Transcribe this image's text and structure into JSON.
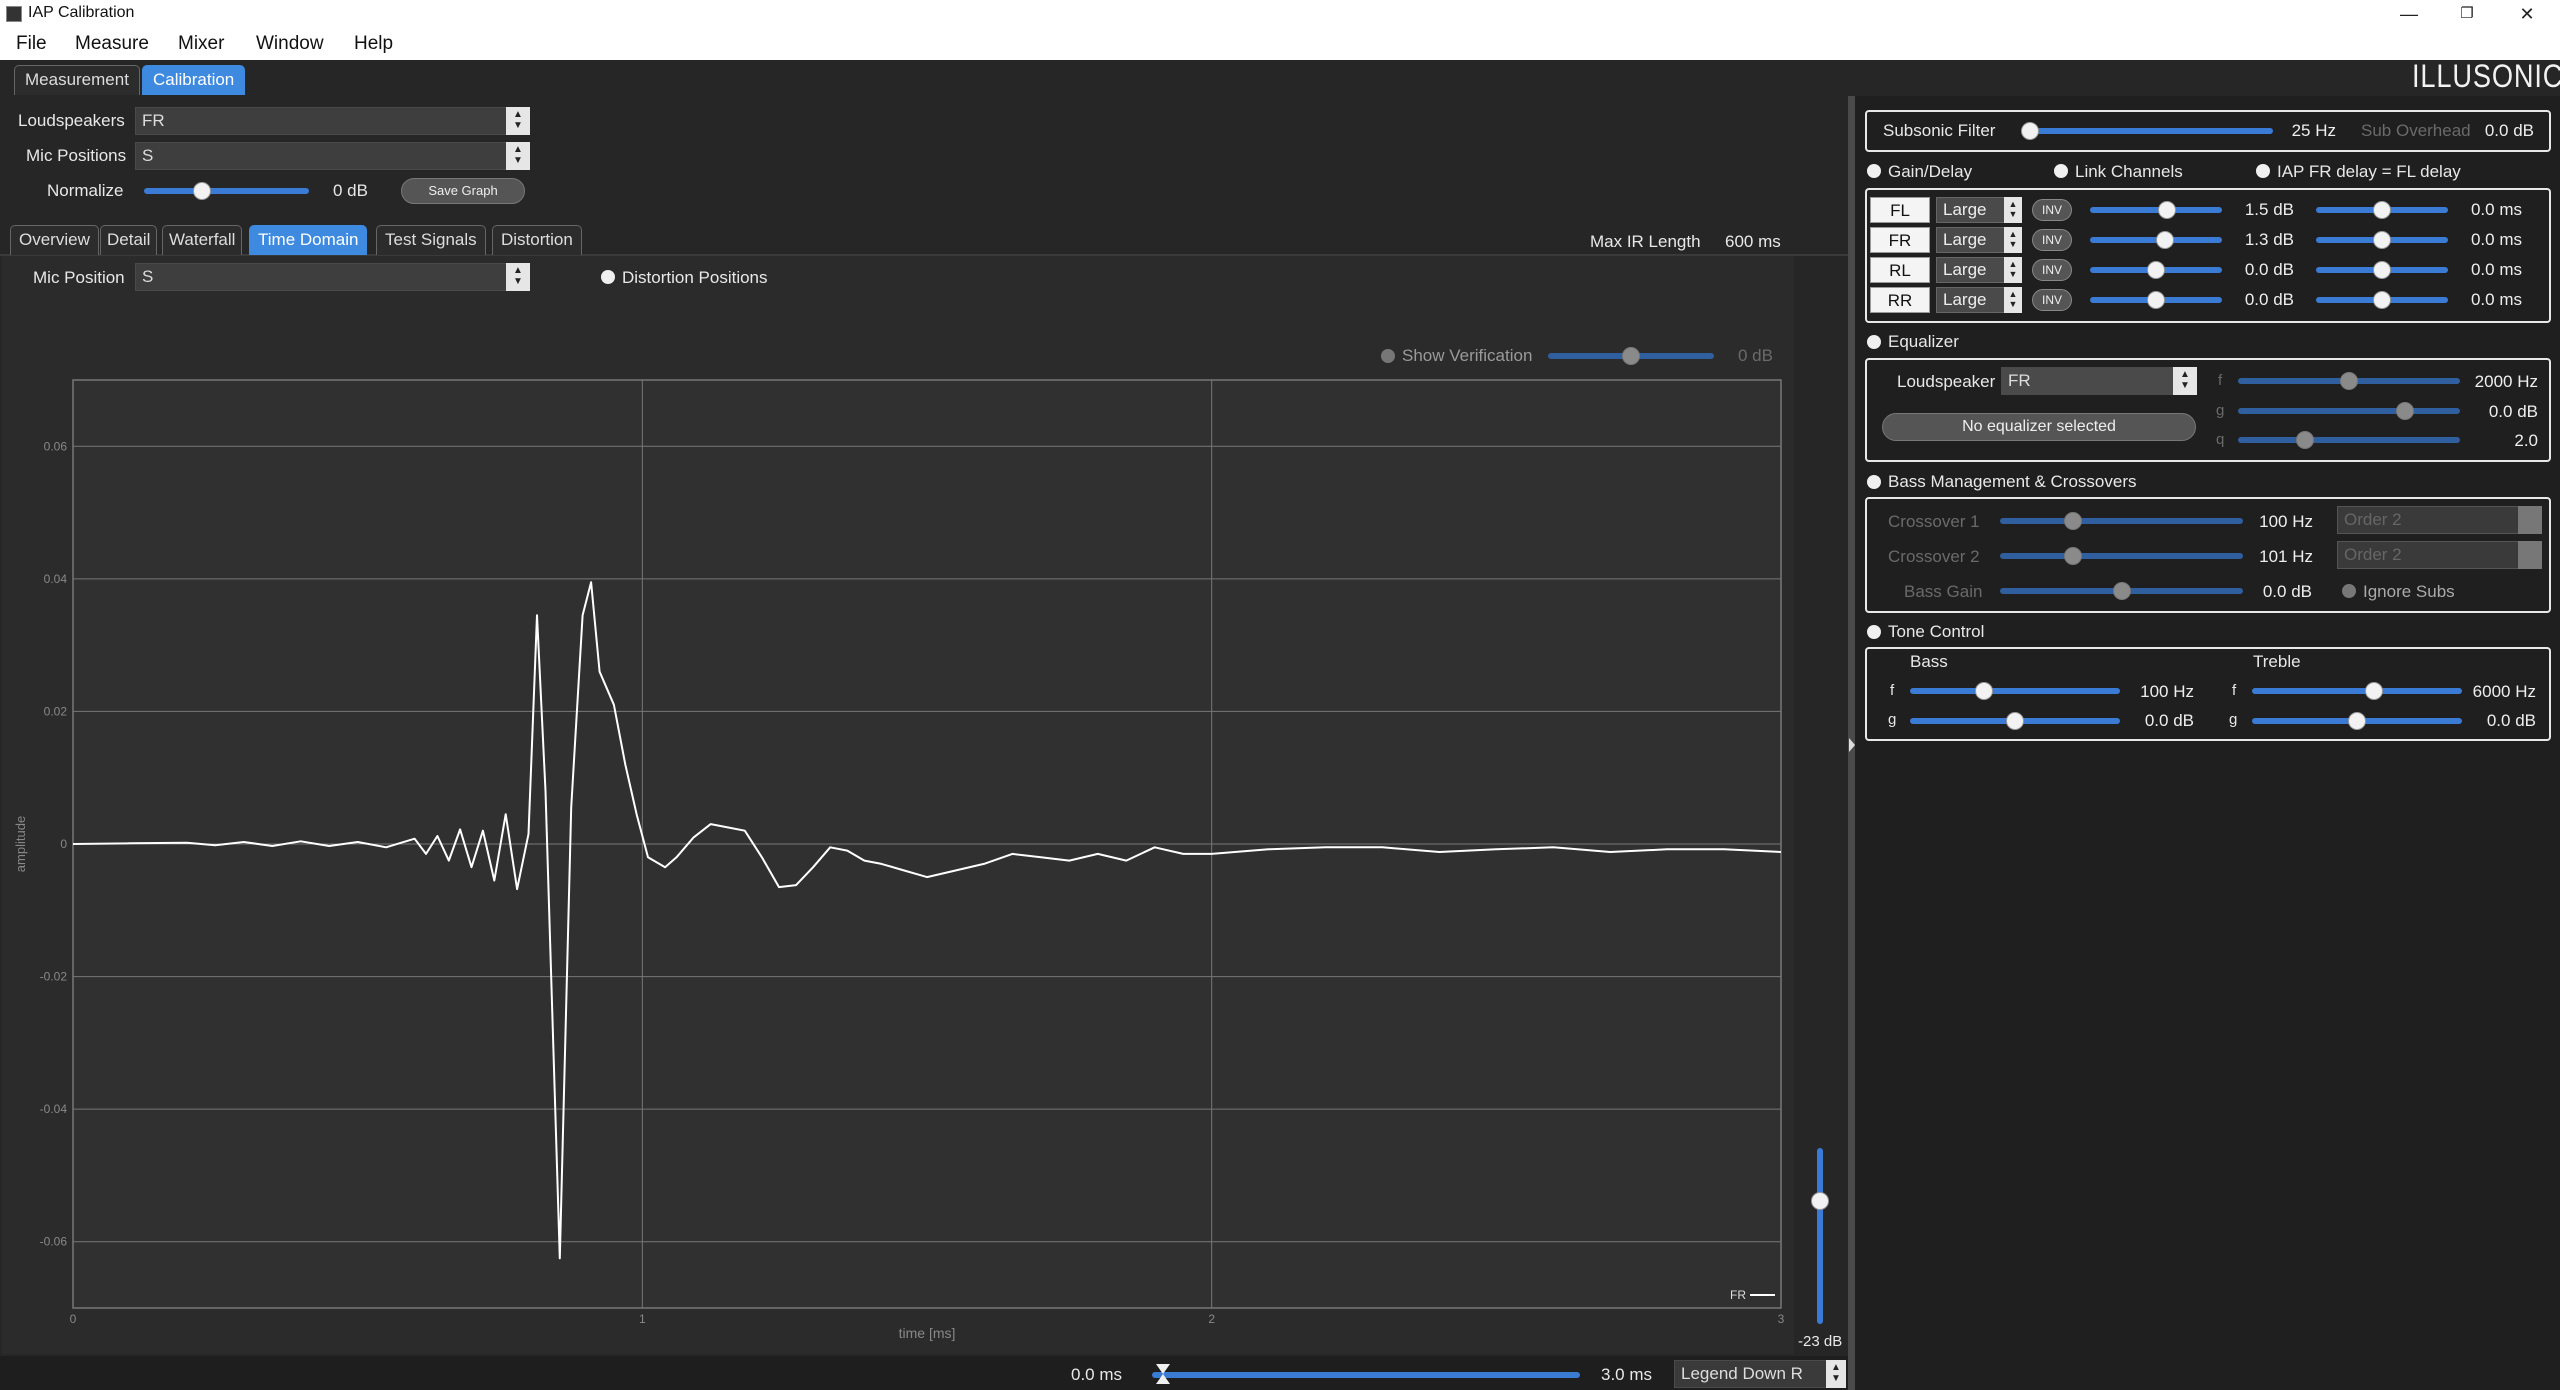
{
  "window": {
    "title": "IAP Calibration",
    "minimize": "—",
    "maximize": "❐",
    "close": "✕"
  },
  "menu": [
    "File",
    "Measure",
    "Mixer",
    "Window",
    "Help"
  ],
  "top_tabs": [
    {
      "label": "Measurement",
      "active": false
    },
    {
      "label": "Calibration",
      "active": true
    }
  ],
  "brand": "ILLUSONIC",
  "left": {
    "loudspeakers_label": "Loudspeakers",
    "loudspeakers_value": "FR",
    "mic_positions_label": "Mic Positions",
    "mic_positions_value": "S",
    "normalize_label": "Normalize",
    "normalize_value": "0 dB",
    "normalize_level": 0.35,
    "save_graph": "Save Graph",
    "view_tabs": [
      {
        "label": "Overview",
        "active": false
      },
      {
        "label": "Detail",
        "active": false
      },
      {
        "label": "Waterfall",
        "active": false
      },
      {
        "label": "Time Domain",
        "active": true
      },
      {
        "label": "Test Signals",
        "active": false
      },
      {
        "label": "Distortion",
        "active": false
      }
    ],
    "max_ir_label": "Max IR Length",
    "max_ir_value": "600 ms",
    "mic_position_label": "Mic Position",
    "mic_position_value": "S",
    "distortion_positions": "Distortion Positions",
    "show_verification": "Show Verification",
    "verification_value": "0 dB",
    "vertical_slider_value": "-23 dB",
    "vertical_slider_level": 0.7,
    "range_start": "0.0 ms",
    "range_end": "3.0 ms",
    "legend_option": "Legend Down R"
  },
  "chart_data": {
    "type": "line",
    "xlabel": "time [ms]",
    "ylabel": "amplitude",
    "xlim": [
      0,
      3
    ],
    "ylim": [
      -0.07,
      0.07
    ],
    "x_ticks": [
      "0",
      "1",
      "2",
      "3"
    ],
    "y_ticks": [
      "0.06",
      "0.04",
      "0.02",
      "0",
      "-0.02",
      "-0.04",
      "-0.06"
    ],
    "grid": true,
    "legend": "bottom-right",
    "series": [
      {
        "name": "FR",
        "color": "#ffffff",
        "x": [
          0,
          0.1,
          0.2,
          0.25,
          0.3,
          0.35,
          0.4,
          0.45,
          0.5,
          0.55,
          0.6,
          0.62,
          0.64,
          0.66,
          0.68,
          0.7,
          0.72,
          0.74,
          0.76,
          0.78,
          0.8,
          0.815,
          0.83,
          0.855,
          0.875,
          0.895,
          0.91,
          0.925,
          0.95,
          0.97,
          0.99,
          1.01,
          1.04,
          1.06,
          1.09,
          1.12,
          1.15,
          1.18,
          1.21,
          1.24,
          1.27,
          1.3,
          1.33,
          1.36,
          1.39,
          1.42,
          1.46,
          1.5,
          1.55,
          1.6,
          1.65,
          1.7,
          1.75,
          1.8,
          1.85,
          1.9,
          1.95,
          2.0,
          2.1,
          2.2,
          2.3,
          2.4,
          2.5,
          2.6,
          2.7,
          2.8,
          2.9,
          3.0
        ],
        "y": [
          0,
          0.0001,
          0.0002,
          -0.0002,
          0.0003,
          -0.0003,
          0.0004,
          -0.0003,
          0.0003,
          -0.0005,
          0.0008,
          -0.0015,
          0.0012,
          -0.0025,
          0.0022,
          -0.0035,
          0.002,
          -0.0055,
          0.0045,
          -0.0068,
          0.0015,
          0.0345,
          0.008,
          -0.0625,
          0.0055,
          0.0345,
          0.0395,
          0.026,
          0.021,
          0.012,
          0.0045,
          -0.002,
          -0.0035,
          -0.002,
          0.001,
          0.003,
          0.0025,
          0.002,
          -0.002,
          -0.0065,
          -0.0062,
          -0.0035,
          -0.0005,
          -0.001,
          -0.0025,
          -0.003,
          -0.004,
          -0.005,
          -0.004,
          -0.003,
          -0.0015,
          -0.002,
          -0.0025,
          -0.0015,
          -0.0025,
          -0.0005,
          -0.0015,
          -0.0015,
          -0.0008,
          -0.0005,
          -0.0005,
          -0.0012,
          -0.0008,
          -0.0005,
          -0.0012,
          -0.0008,
          -0.0008,
          -0.0012
        ]
      }
    ]
  },
  "right": {
    "subsonic_label": "Subsonic Filter",
    "subsonic_value": "25 Hz",
    "subsonic_level": 0.02,
    "sub_overhead_label": "Sub Overhead",
    "sub_overhead_value": "0.0 dB",
    "gain_delay": "Gain/Delay",
    "link_channels": "Link Channels",
    "iap_fr_delay": "IAP FR delay = FL delay",
    "inv": "INV",
    "channels": [
      {
        "name": "FL",
        "size": "Large",
        "gain": "1.5 dB",
        "gain_level": 0.58,
        "delay": "0.0 ms",
        "delay_level": 0.5
      },
      {
        "name": "FR",
        "size": "Large",
        "gain": "1.3 dB",
        "gain_level": 0.57,
        "delay": "0.0 ms",
        "delay_level": 0.5
      },
      {
        "name": "RL",
        "size": "Large",
        "gain": "0.0 dB",
        "gain_level": 0.5,
        "delay": "0.0 ms",
        "delay_level": 0.5
      },
      {
        "name": "RR",
        "size": "Large",
        "gain": "0.0 dB",
        "gain_level": 0.5,
        "delay": "0.0 ms",
        "delay_level": 0.5
      }
    ],
    "equalizer": "Equalizer",
    "eq_loudspeaker_label": "Loudspeaker",
    "eq_loudspeaker_value": "FR",
    "no_equalizer": "No equalizer selected",
    "eq_f_label": "f",
    "eq_f_value": "2000 Hz",
    "eq_f_level": 0.5,
    "eq_g_label": "g",
    "eq_g_value": "0.0 dB",
    "eq_g_level": 0.75,
    "eq_q_label": "q",
    "eq_q_value": "2.0",
    "eq_q_level": 0.3,
    "bass_mgmt": "Bass Management & Crossovers",
    "crossover1_label": "Crossover 1",
    "crossover1_value": "100 Hz",
    "crossover1_level": 0.3,
    "crossover1_order": "Order 2",
    "crossover2_label": "Crossover 2",
    "crossover2_value": "101 Hz",
    "crossover2_level": 0.3,
    "crossover2_order": "Order 2",
    "bass_gain_label": "Bass Gain",
    "bass_gain_value": "0.0 dB",
    "bass_gain_level": 0.5,
    "ignore_subs": "Ignore Subs",
    "tone_control": "Tone Control",
    "bass_label": "Bass",
    "treble_label": "Treble",
    "f_label": "f",
    "g_label": "g",
    "bass_f_value": "100 Hz",
    "bass_f_level": 0.35,
    "bass_g_value": "0.0 dB",
    "bass_g_level": 0.5,
    "treble_f_value": "6000 Hz",
    "treble_f_level": 0.58,
    "treble_g_value": "0.0 dB",
    "treble_g_level": 0.5
  }
}
